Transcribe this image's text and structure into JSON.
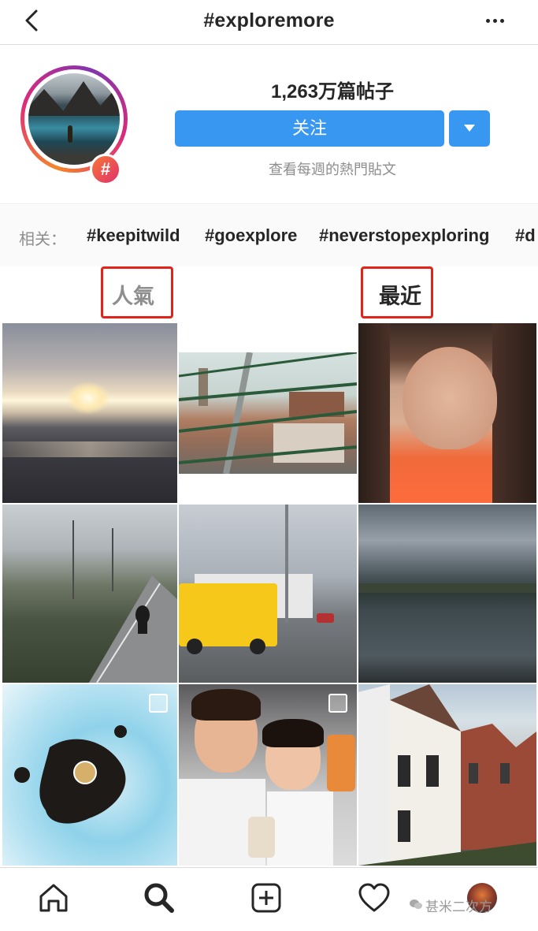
{
  "header": {
    "title": "#exploremore",
    "back_icon": "chevron-left-icon",
    "more_icon": "more-horizontal-icon"
  },
  "profile": {
    "posts_count": "1,263万篇帖子",
    "follow_label": "关注",
    "weekly_link": "查看每週的熱門貼文",
    "badge_symbol": "#"
  },
  "related": {
    "label": "相关：",
    "tags": [
      "#keepitwild",
      "#goexplore",
      "#neverstopexploring",
      "#d"
    ]
  },
  "sections": {
    "top_label": "人氣",
    "recent_label": "最近"
  },
  "colors": {
    "accent_blue": "#3897f0",
    "annotation_red": "#e2231a"
  },
  "nav": {
    "items": [
      "home-icon",
      "search-icon",
      "add-post-icon",
      "heart-icon",
      "profile-icon"
    ]
  },
  "watermark": "甚米二次方"
}
